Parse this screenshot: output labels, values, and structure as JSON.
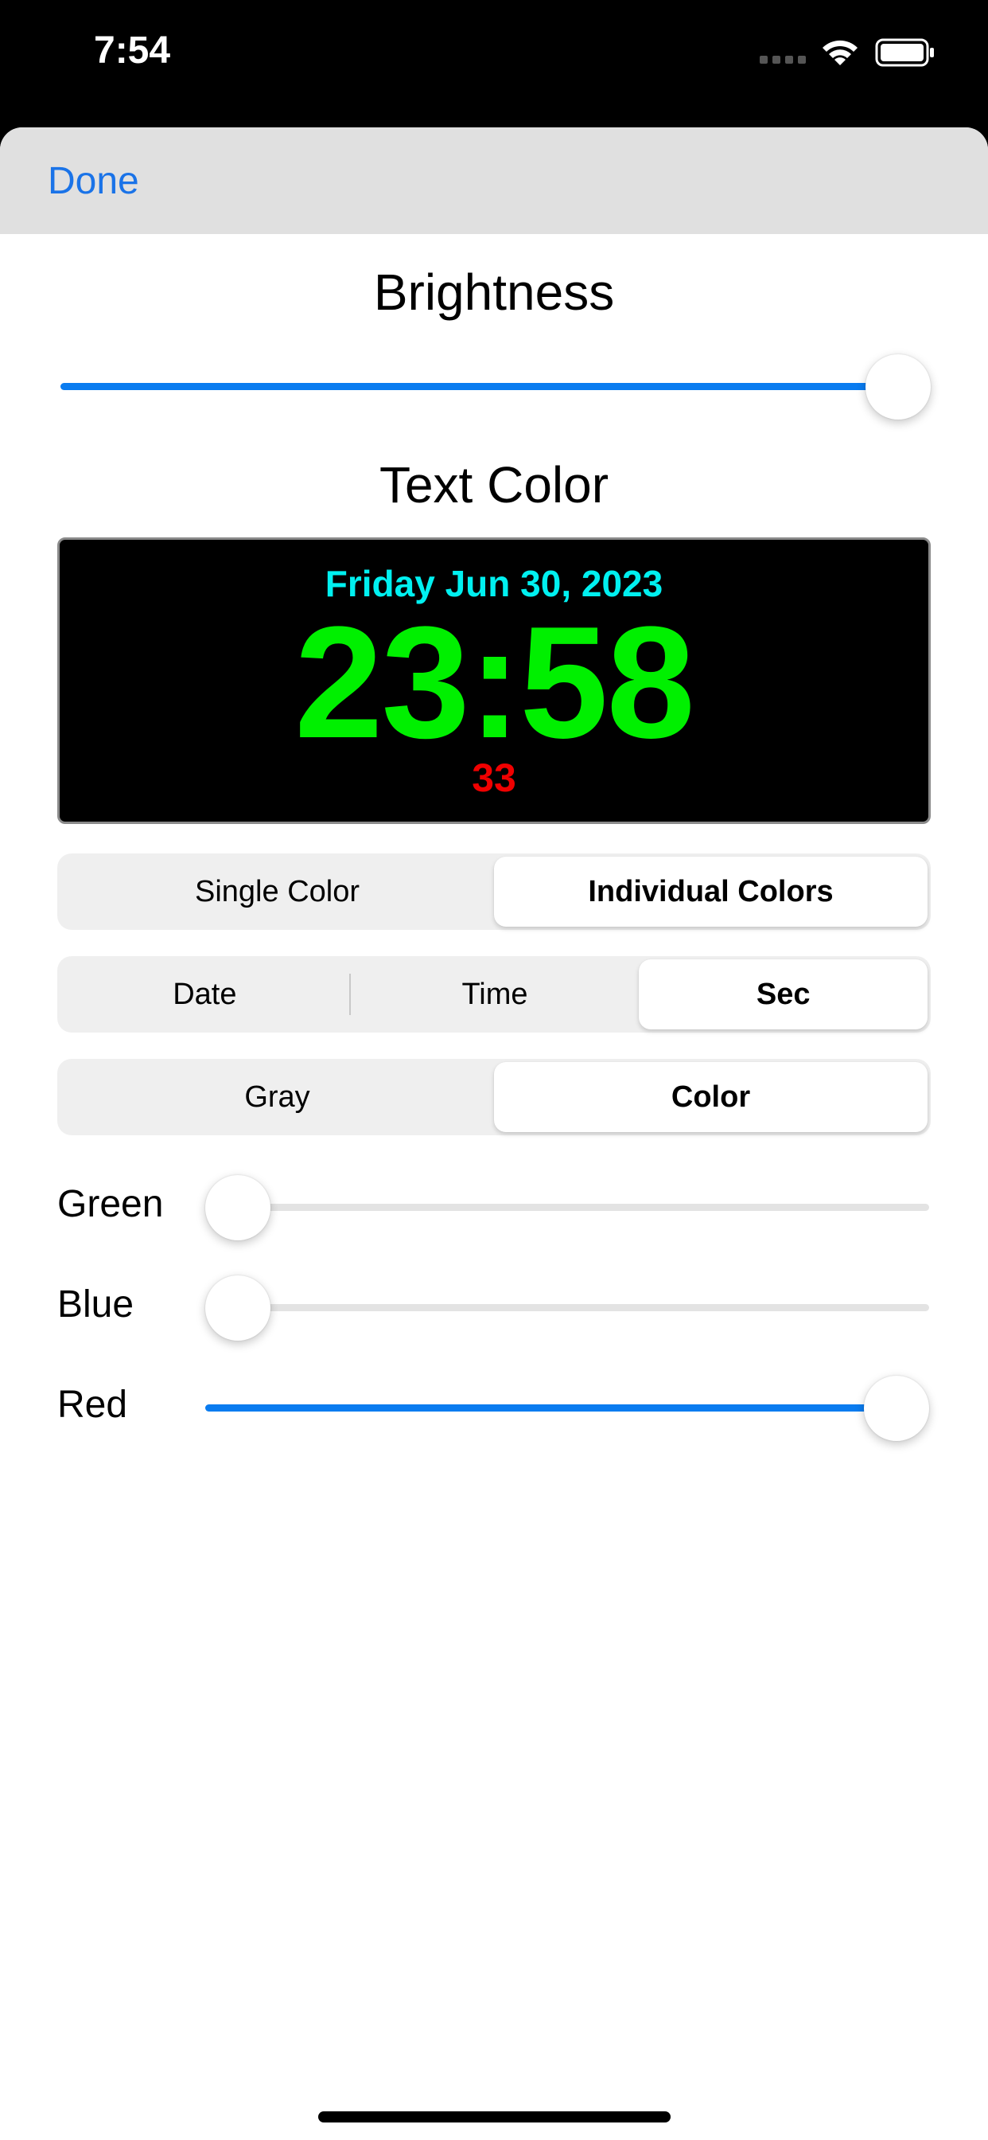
{
  "status_bar": {
    "time": "7:54",
    "icons": [
      "signal-icon",
      "wifi-icon",
      "battery-icon"
    ]
  },
  "nav": {
    "done_label": "Done"
  },
  "brightness": {
    "title": "Brightness",
    "value": 1.0
  },
  "text_color": {
    "title": "Text Color"
  },
  "preview": {
    "date": "Friday Jun 30, 2023",
    "time": "23:58",
    "seconds": "33",
    "colors": {
      "date": "#00f0f0",
      "time": "#00f000",
      "seconds": "#f00000",
      "background": "#000000"
    }
  },
  "mode_control": {
    "segments": [
      "Single Color",
      "Individual Colors"
    ],
    "selected": "Individual Colors"
  },
  "part_control": {
    "segments": [
      "Date",
      "Time",
      "Sec"
    ],
    "selected": "Sec"
  },
  "palette_control": {
    "segments": [
      "Gray",
      "Color"
    ],
    "selected": "Color"
  },
  "channels": {
    "green": {
      "label": "Green",
      "value": 0.0
    },
    "blue": {
      "label": "Blue",
      "value": 0.0
    },
    "red": {
      "label": "Red",
      "value": 1.0
    }
  },
  "colors": {
    "accent": "#0a7cf0",
    "nav_background": "#e0e0e0",
    "segment_background": "#efefef"
  }
}
